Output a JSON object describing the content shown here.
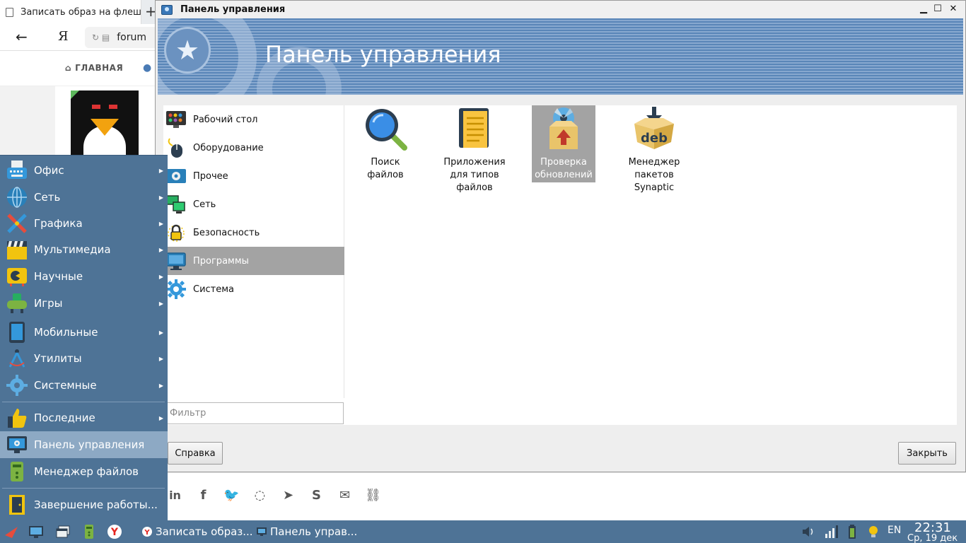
{
  "browser": {
    "tab_title": "Записать образ на флеш",
    "new_tab": "+",
    "back_icon": "←",
    "yandex_label": "Я",
    "url": "forum",
    "nav_home": "ГЛАВНАЯ"
  },
  "control_panel": {
    "window_title": "Панель управления",
    "banner_title": "Панель управления",
    "categories": [
      {
        "label": "Рабочий стол",
        "icon": "desktop-icon"
      },
      {
        "label": "Оборудование",
        "icon": "mouse-icon"
      },
      {
        "label": "Прочее",
        "icon": "gear-monitor-icon"
      },
      {
        "label": "Сеть",
        "icon": "network-icon"
      },
      {
        "label": "Безопасность",
        "icon": "lock-icon"
      },
      {
        "label": "Программы",
        "icon": "monitor-icon",
        "selected": true
      },
      {
        "label": "Система",
        "icon": "gear-icon"
      }
    ],
    "filter_placeholder": "Фильтр",
    "apps": [
      {
        "label_lines": [
          "Поиск",
          "файлов"
        ],
        "icon": "magnifier-icon"
      },
      {
        "label_lines": [
          "Приложения",
          "для типов",
          "файлов"
        ],
        "icon": "document-icon"
      },
      {
        "label_lines": [
          "Проверка",
          "обновлений"
        ],
        "icon": "update-box-icon",
        "selected": true
      },
      {
        "label_lines": [
          "Менеджер",
          "пакетов",
          "Synaptic"
        ],
        "icon": "deb-package-icon"
      }
    ],
    "help_button": "Справка",
    "close_button": "Закрыть"
  },
  "start_menu": {
    "items": [
      {
        "label": "Офис",
        "icon": "typewriter-icon",
        "submenu": true
      },
      {
        "label": "Сеть",
        "icon": "globe-icon",
        "submenu": true
      },
      {
        "label": "Графика",
        "icon": "brush-icon",
        "submenu": true
      },
      {
        "label": "Мультимедиа",
        "icon": "clapperboard-icon",
        "submenu": true
      },
      {
        "label": "Научные",
        "icon": "science-icon",
        "submenu": true
      },
      {
        "label": "Игры",
        "icon": "gamepad-icon",
        "submenu": true
      },
      {
        "label": "Мобильные",
        "icon": "tablet-icon",
        "submenu": true
      },
      {
        "label": "Утилиты",
        "icon": "compass-icon",
        "submenu": true
      },
      {
        "label": "Системные",
        "icon": "gear-icon",
        "submenu": true
      },
      {
        "label": "Последние",
        "icon": "thumbs-up-icon",
        "submenu": true
      },
      {
        "label": "Панель управления",
        "icon": "control-panel-icon",
        "selected": true
      },
      {
        "label": "Менеджер файлов",
        "icon": "file-manager-icon"
      },
      {
        "label": "Завершение работы...",
        "icon": "door-exit-icon"
      }
    ]
  },
  "taskbar": {
    "tasks": [
      {
        "label": "Записать образ...",
        "icon": "yandex-browser-icon"
      },
      {
        "label": "Панель управ...",
        "icon": "control-panel-icon"
      }
    ],
    "lang": "EN",
    "time": "22:31",
    "date": "Ср, 19 дек"
  },
  "colors": {
    "menu_bg": "#4e7396",
    "menu_selected": "#8da9c4",
    "category_selected": "#a3a3a3",
    "banner_blue": "#5a86b8"
  }
}
